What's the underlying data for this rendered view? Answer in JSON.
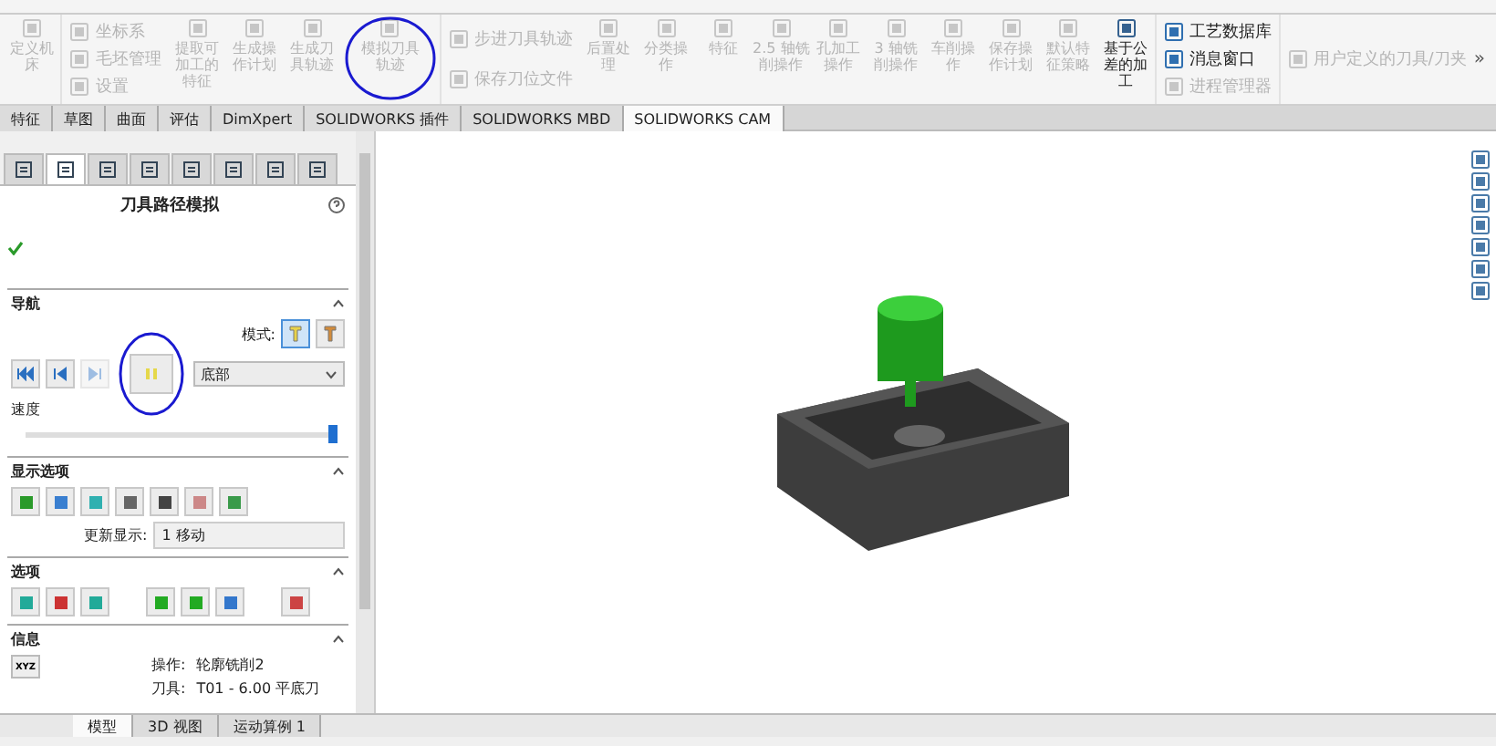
{
  "ribbon": {
    "items": [
      {
        "kind": "large",
        "label": "定义机床",
        "disabled": true
      },
      {
        "kind": "stack",
        "entries": [
          {
            "label": "坐标系",
            "disabled": true
          },
          {
            "label": "毛坯管理",
            "disabled": true
          },
          {
            "label": "设置",
            "disabled": true
          }
        ]
      },
      {
        "kind": "large",
        "label": "提取可加工的特征",
        "disabled": true
      },
      {
        "kind": "large",
        "label": "生成操作计划",
        "disabled": true
      },
      {
        "kind": "large",
        "label": "生成刀具轨迹",
        "disabled": true
      },
      {
        "kind": "large",
        "label": "模拟刀具轨迹",
        "disabled": true,
        "annotated": true
      },
      {
        "kind": "stack",
        "entries": [
          {
            "label": "步进刀具轨迹",
            "disabled": true
          },
          {
            "label": "保存刀位文件",
            "disabled": true
          }
        ]
      },
      {
        "kind": "large",
        "label": "后置处理",
        "disabled": true
      },
      {
        "kind": "large",
        "label": "分类操作",
        "disabled": true
      },
      {
        "kind": "large",
        "label": "特征",
        "disabled": true
      },
      {
        "kind": "large",
        "label": "2.5 轴铣削操作",
        "disabled": true
      },
      {
        "kind": "large",
        "label": "孔加工操作",
        "disabled": true
      },
      {
        "kind": "large",
        "label": "3 轴铣削操作",
        "disabled": true
      },
      {
        "kind": "large",
        "label": "车削操作",
        "disabled": true
      },
      {
        "kind": "large",
        "label": "保存操作计划",
        "disabled": true
      },
      {
        "kind": "large",
        "label": "默认特征策略",
        "disabled": true
      },
      {
        "kind": "large",
        "label": "基于公差的加工",
        "disabled": false
      },
      {
        "kind": "stack",
        "entries": [
          {
            "label": "工艺数据库",
            "disabled": false
          },
          {
            "label": "消息窗口",
            "disabled": false
          },
          {
            "label": "进程管理器",
            "disabled": true
          }
        ]
      },
      {
        "kind": "stack",
        "entries": [
          {
            "label": "用户定义的刀具/刀夹",
            "disabled": true
          }
        ]
      }
    ],
    "more": "»"
  },
  "tabs": [
    {
      "label": "特征",
      "selected": false
    },
    {
      "label": "草图",
      "selected": false
    },
    {
      "label": "曲面",
      "selected": false
    },
    {
      "label": "评估",
      "selected": false
    },
    {
      "label": "DimXpert",
      "selected": false
    },
    {
      "label": "SOLIDWORKS 插件",
      "selected": false
    },
    {
      "label": "SOLIDWORKS MBD",
      "selected": false
    },
    {
      "label": "SOLIDWORKS CAM",
      "selected": true
    }
  ],
  "panel": {
    "icon_tabs": [
      {
        "selected": false
      },
      {
        "selected": true
      },
      {
        "selected": false
      },
      {
        "selected": false
      },
      {
        "selected": false
      },
      {
        "selected": false
      },
      {
        "selected": false
      },
      {
        "selected": false
      }
    ],
    "title": "刀具路径模拟",
    "navigation": {
      "title": "导航",
      "mode_label": "模式:",
      "modes": [
        {
          "selected": true
        },
        {
          "selected": false
        }
      ],
      "controls": [
        {
          "disabled": false
        },
        {
          "disabled": false
        },
        {
          "disabled": true
        },
        {
          "disabled": false,
          "annotated": true
        }
      ],
      "dropdown": "底部",
      "speed_label": "速度",
      "speed": {
        "level": 1
      }
    },
    "display": {
      "title": "显示选项",
      "update_label": "更新显示:",
      "update_value": "1 移动"
    },
    "options": {
      "title": "选项"
    },
    "info": {
      "title": "信息",
      "xyz": "XYZ",
      "rows": [
        {
          "label": "操作:",
          "value": "轮廓铣削2"
        },
        {
          "label": "刀具:",
          "value": "T01 - 6.00 平底刀"
        }
      ]
    }
  },
  "bottom_tabs": [
    {
      "label": "模型",
      "selected": true
    },
    {
      "label": "3D 视图",
      "selected": false
    },
    {
      "label": "运动算例 1",
      "selected": false
    }
  ]
}
